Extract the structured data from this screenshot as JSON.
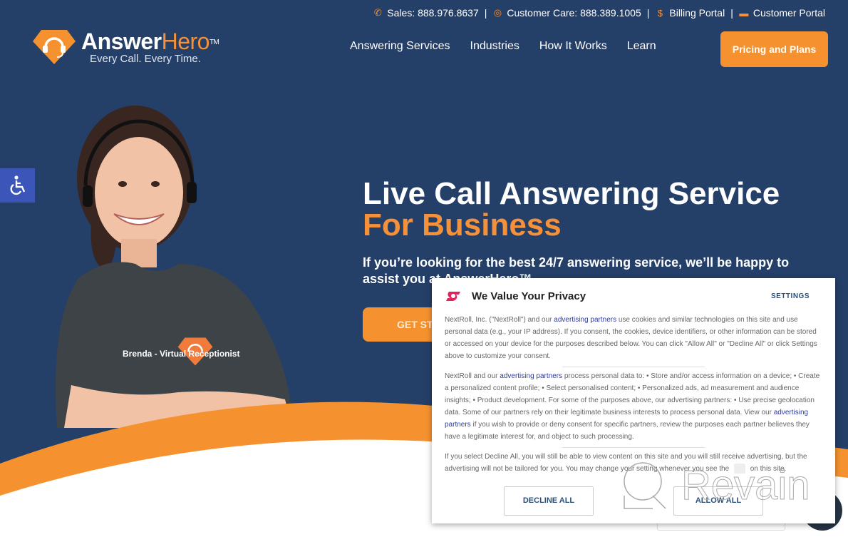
{
  "topbar": {
    "sales": "Sales: 888.976.8637",
    "care": "Customer Care: 888.389.1005",
    "billing": "Billing Portal",
    "portal": "Customer Portal",
    "separator": "|"
  },
  "logo": {
    "part1": "Answer",
    "part2": "Hero",
    "tm": "TM",
    "tagline": "Every Call. Every Time."
  },
  "nav": {
    "items": [
      "Answering Services",
      "Industries",
      "How It Works",
      "Learn"
    ],
    "cta": "Pricing and Plans"
  },
  "hero": {
    "title_line1": "Live Call Answering Service",
    "title_line2": "For Business",
    "subtitle": "If you’re looking for the best 24/7 answering service, we’ll be happy to assist you at AnswerHero™",
    "button": "GET STARTED",
    "caption": "Brenda - Virtual Receptionist"
  },
  "consent": {
    "title": "We Value Your Privacy",
    "settings": "SETTINGS",
    "p1_a": "NextRoll, Inc. (\"NextRoll\") and our ",
    "p1_link": "advertising partners",
    "p1_b": " use cookies and similar technologies on this site and use personal data (e.g., your IP address). If you consent, the cookies, device identifiers, or other information can be stored or accessed on your device for the purposes described below. You can click \"Allow All\" or \"Decline All\" or click Settings above to customize your consent.",
    "p2_a": "NextRoll and our ",
    "p2_link1": "advertising partners",
    "p2_b": " process personal data to: • Store and/or access information on a device; • Create a personalized content profile; • Select personalised content; • Personalized ads, ad measurement and audience insights; • Product development. For some of the purposes above, our advertising partners: • Use precise geolocation data. Some of our partners rely on their legitimate business interests to process personal data. View our ",
    "p2_link2": "advertising partners",
    "p2_c": " if you wish to provide or deny consent for specific partners, review the purposes each partner believes they have a legitimate interest for, and object to such processing.",
    "p3_a": "If you select Decline All, you will still be able to view content on this site and you will still receive advertising, but the advertising will not be tailored for you. You may change your setting whenever you see the ",
    "p3_b": " on this site.",
    "decline": "DECLINE ALL",
    "allow": "ALLOW ALL"
  },
  "watermark": "Revain",
  "colors": {
    "navy": "#243f68",
    "orange": "#f5922f",
    "a11y_blue": "#3b55b8",
    "nextroll_red": "#e0245e"
  }
}
